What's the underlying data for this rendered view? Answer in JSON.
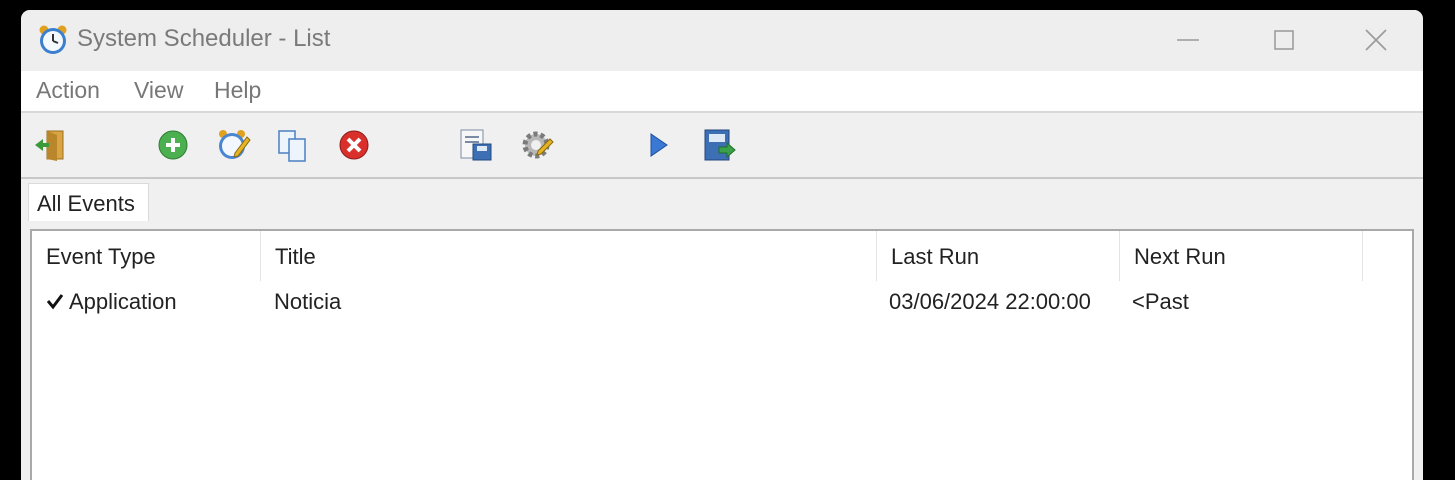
{
  "window": {
    "title": "System Scheduler - List"
  },
  "menu": {
    "items": [
      "Action",
      "View",
      "Help"
    ]
  },
  "toolbar": {
    "buttons": [
      {
        "icon": "exit-icon"
      },
      {
        "icon": "add-event-icon"
      },
      {
        "icon": "edit-event-icon"
      },
      {
        "icon": "copy-event-icon"
      },
      {
        "icon": "delete-event-icon"
      },
      {
        "icon": "save-list-icon"
      },
      {
        "icon": "preferences-icon"
      },
      {
        "icon": "run-event-icon"
      },
      {
        "icon": "export-log-icon"
      }
    ]
  },
  "tabs": [
    {
      "label": "All Events",
      "active": true
    }
  ],
  "list": {
    "columns": [
      "Event Type",
      "Title",
      "Last Run",
      "Next Run"
    ],
    "rows": [
      {
        "checked": true,
        "event_type": "Application",
        "title": "Noticia",
        "last_run": "03/06/2024 22:00:00",
        "next_run": "<Past"
      }
    ]
  },
  "colors": {
    "title_text": "#7a7a7a",
    "menu_text": "#777777",
    "add_green": "#4caf50",
    "delete_red": "#d9302c",
    "run_blue": "#3a78d6"
  }
}
